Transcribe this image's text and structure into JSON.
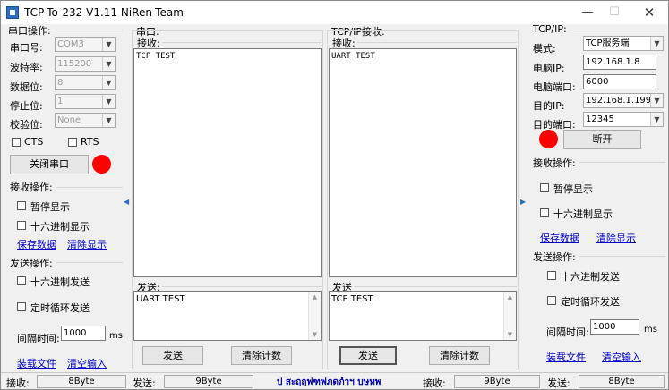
{
  "window": {
    "title": "TCP-To-232 V1.11   NiRen-Team"
  },
  "left": {
    "serial_ops_title": "串口操作:",
    "port_label": "串口号:",
    "port_value": "COM3",
    "baud_label": "波特率:",
    "baud_value": "115200",
    "databits_label": "数据位:",
    "databits_value": "8",
    "stopbits_label": "停止位:",
    "stopbits_value": "1",
    "parity_label": "校验位:",
    "parity_value": "None",
    "cts_label": "CTS",
    "rts_label": "RTS",
    "close_button": "关闭串口",
    "recv_title": "接收操作:",
    "pause_label": "暂停显示",
    "hex_show_label": "十六进制显示",
    "save_link": "保存数据",
    "clear_show_link": "清除显示",
    "send_title": "发送操作:",
    "hex_send_label": "十六进制发送",
    "loop_send_label": "定时循环发送",
    "interval_label": "间隔时间:",
    "interval_value": "1000",
    "interval_unit": "ms",
    "load_link": "装载文件",
    "clear_input_link": "清空输入"
  },
  "serial_panel": {
    "title": "串口:",
    "recv_label": "接收:",
    "recv_text": "TCP TEST",
    "send_label": "发送:",
    "send_text": "UART TEST",
    "send_button": "发送",
    "clear_count_button": "清除计数"
  },
  "tcp_panel": {
    "title": "TCP/IP接收:",
    "recv_label": "接收:",
    "recv_text": "UART TEST",
    "send_label": "发送",
    "send_text": "TCP TEST",
    "send_button": "发送",
    "clear_count_button": "清除计数"
  },
  "right": {
    "tcpip_title": "TCP/IP:",
    "mode_label": "模式:",
    "mode_value": "TCP服务端",
    "pc_ip_label": "电脑IP:",
    "pc_ip_value": "192.168.1.8",
    "pc_port_label": "电脑端口:",
    "pc_port_value": "6000",
    "target_ip_label": "目的IP:",
    "target_ip_value": "192.168.1.199",
    "target_port_label": "目的端口:",
    "target_port_value": "12345",
    "disconnect_button": "断开",
    "recv_title": "接收操作:",
    "pause_label": "暂停显示",
    "hex_show_label": "十六进制显示",
    "save_link": "保存数据",
    "clear_show_link": "清除显示",
    "send_title": "发送操作:",
    "hex_send_label": "十六进制发送",
    "loop_send_label": "定时循环发送",
    "interval_label": "间隔时间:",
    "interval_value": "1000",
    "interval_unit": "ms",
    "load_link": "装载文件",
    "clear_input_link": "清空输入"
  },
  "statusbar": {
    "recv1_label": "接收:",
    "recv1_value": "8Byte",
    "send1_label": "发送:",
    "send1_value": "9Byte",
    "center_link": "ป สะฤฤฟฑฟภดภ์าฯ บษหพ",
    "recv2_label": "接收:",
    "recv2_value": "9Byte",
    "send2_label": "发送:",
    "send2_value": "8Byte"
  },
  "colors": {
    "indicator": "#ff0000",
    "link": "#0000cc"
  }
}
